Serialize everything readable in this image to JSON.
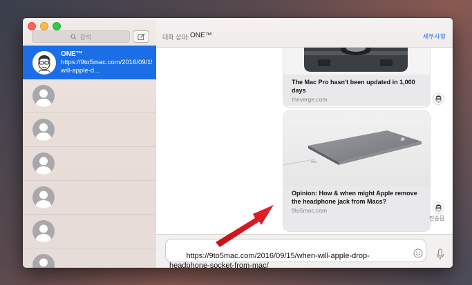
{
  "sidebar": {
    "search_placeholder": "검색",
    "conversations": [
      {
        "name": "ONE™",
        "preview": "https://9to5mac.com/2016/09/15/when-will-apple-d..."
      }
    ]
  },
  "header": {
    "to_label": "대화 상대:",
    "recipient": "ONE™",
    "details_label": "세부사항"
  },
  "thread": {
    "messages": [
      {
        "title": "The Mac Pro hasn't been updated in 1,000 days",
        "domain": "theverge.com"
      },
      {
        "title": "Opinion: How & when might Apple remove the headphone jack from Macs?",
        "domain": "9to5mac.com"
      }
    ],
    "status": "전송됨"
  },
  "composer": {
    "text": "https://9to5mac.com/2016/09/15/when-will-apple-drop-headphone-socket-from-mac/"
  },
  "colors": {
    "accent": "#1b6ee6",
    "annotation_arrow": "#d8141c"
  }
}
